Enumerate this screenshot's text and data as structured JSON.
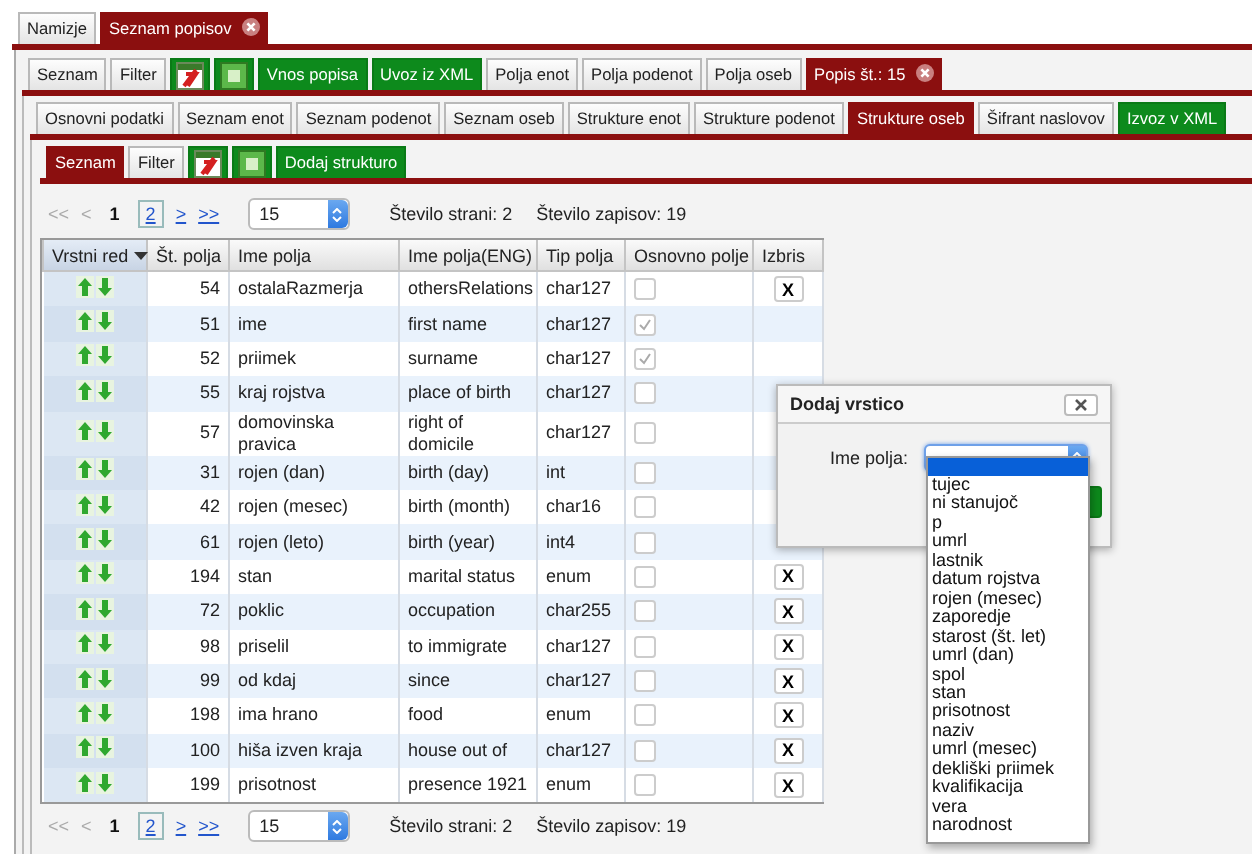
{
  "top_tabs": [
    {
      "label": "Namizje",
      "kind": "tab",
      "selected": false,
      "closable": false
    },
    {
      "label": "Seznam popisov",
      "kind": "tab",
      "selected": true,
      "closable": true
    }
  ],
  "popis_tabs": [
    {
      "label": "Seznam",
      "kind": "tab",
      "selected": false
    },
    {
      "label": "Filter",
      "kind": "tab",
      "selected": false
    },
    {
      "kind": "pdf",
      "selected": false
    },
    {
      "kind": "xls",
      "selected": false
    },
    {
      "label": "Vnos popisa",
      "kind": "action",
      "selected": false
    },
    {
      "label": "Uvoz iz XML",
      "kind": "action",
      "selected": false
    },
    {
      "label": "Polja enot",
      "kind": "tab",
      "selected": false
    },
    {
      "label": "Polja podenot",
      "kind": "tab",
      "selected": false
    },
    {
      "label": "Polja oseb",
      "kind": "tab",
      "selected": false
    },
    {
      "label": "Popis št.: 15",
      "kind": "tab",
      "selected": true,
      "closable": true
    }
  ],
  "detail_tabs": [
    {
      "label": "Osnovni podatki",
      "kind": "tab",
      "selected": false
    },
    {
      "label": "Seznam enot",
      "kind": "tab",
      "selected": false
    },
    {
      "label": "Seznam podenot",
      "kind": "tab",
      "selected": false
    },
    {
      "label": "Seznam oseb",
      "kind": "tab",
      "selected": false
    },
    {
      "label": "Strukture enot",
      "kind": "tab",
      "selected": false
    },
    {
      "label": "Strukture podenot",
      "kind": "tab",
      "selected": false
    },
    {
      "label": "Strukture oseb",
      "kind": "tab",
      "selected": true
    },
    {
      "label": "Šifrant naslovov",
      "kind": "tab",
      "selected": false
    },
    {
      "label": "Izvoz v XML",
      "kind": "action",
      "selected": false
    }
  ],
  "structure_tabs": [
    {
      "label": "Seznam",
      "kind": "tab",
      "selected": true
    },
    {
      "label": "Filter",
      "kind": "tab",
      "selected": false
    },
    {
      "kind": "pdf",
      "selected": false
    },
    {
      "kind": "xls",
      "selected": false
    },
    {
      "label": "Dodaj strukturo",
      "kind": "action",
      "selected": false
    }
  ],
  "pager_top": {
    "first": "<<",
    "prev": "<",
    "pages": [
      {
        "label": "1",
        "selected": true
      },
      {
        "label": "2",
        "selected": false
      }
    ],
    "next": ">",
    "last": ">>",
    "page_size": "15",
    "page_count": "Število strani: 2",
    "record_count": "Število zapisov: 19"
  },
  "table": {
    "columns": [
      {
        "label": "Vrstni red",
        "sorted": true
      },
      {
        "label": "Št. polja",
        "sorted": false
      },
      {
        "label": "Ime polja",
        "sorted": false
      },
      {
        "label": "Ime polja(ENG)",
        "sorted": false
      },
      {
        "label": "Tip polja",
        "sorted": false
      },
      {
        "label": "Osnovno polje",
        "sorted": false
      },
      {
        "label": "Izbris",
        "sorted": false
      }
    ],
    "rows": [
      {
        "number": "54",
        "name": "ostalaRazmerja",
        "name_eng": "othersRelations",
        "type": "char127",
        "basic": false,
        "delete": "X"
      },
      {
        "number": "51",
        "name": "ime",
        "name_eng": "first name",
        "type": "char127",
        "basic": true
      },
      {
        "number": "52",
        "name": "priimek",
        "name_eng": "surname",
        "type": "char127",
        "basic": true
      },
      {
        "number": "55",
        "name": "kraj rojstva",
        "name_eng": "place of birth",
        "type": "char127",
        "basic": false
      },
      {
        "number": "57",
        "name": "domovinska pravica",
        "name_eng": "right of domicile",
        "type": "char127",
        "basic": false
      },
      {
        "number": "31",
        "name": "rojen (dan)",
        "name_eng": "birth (day)",
        "type": "int",
        "basic": false
      },
      {
        "number": "42",
        "name": "rojen (mesec)",
        "name_eng": "birth (month)",
        "type": "char16",
        "basic": false
      },
      {
        "number": "61",
        "name": "rojen (leto)",
        "name_eng": "birth (year)",
        "type": "int4",
        "basic": false
      },
      {
        "number": "194",
        "name": "stan",
        "name_eng": "marital status",
        "type": "enum",
        "basic": false,
        "delete": "X"
      },
      {
        "number": "72",
        "name": "poklic",
        "name_eng": "occupation",
        "type": "char255",
        "basic": false,
        "delete": "X"
      },
      {
        "number": "98",
        "name": "priselil",
        "name_eng": "to immigrate",
        "type": "char127",
        "basic": false,
        "delete": "X"
      },
      {
        "number": "99",
        "name": "od kdaj",
        "name_eng": "since",
        "type": "char127",
        "basic": false,
        "delete": "X"
      },
      {
        "number": "198",
        "name": "ima hrano",
        "name_eng": "food",
        "type": "enum",
        "basic": false,
        "delete": "X"
      },
      {
        "number": "100",
        "name": "hiša izven kraja",
        "name_eng": "house out of",
        "type": "char127",
        "basic": false,
        "delete": "X"
      },
      {
        "number": "199",
        "name": "prisotnost",
        "name_eng": "presence 1921",
        "type": "enum",
        "basic": false,
        "delete": "X"
      }
    ]
  },
  "pager_bottom": {
    "first": "<<",
    "prev": "<",
    "pages": [
      {
        "label": "1",
        "selected": true
      },
      {
        "label": "2",
        "selected": false
      }
    ],
    "next": ">",
    "last": ">>",
    "page_size": "15",
    "page_count": "Število strani: 2",
    "record_count": "Število zapisov: 19"
  },
  "dialog": {
    "title": "Dodaj vrstico",
    "field_label": "Ime polja:",
    "dropdown": {
      "expanded": true,
      "blank_highlighted": true,
      "options": [
        "tujec",
        "ni stanujoč",
        "p",
        "umrl",
        "lastnik",
        "datum rojstva",
        "rojen (mesec)",
        "zaporedje",
        "starost (št. let)",
        "umrl (dan)",
        "spol",
        "stan",
        "prisotnost",
        "naziv",
        "umrl (mesec)",
        "dekliški priimek",
        "kvalifikacija",
        "vera",
        "narodnost"
      ]
    }
  }
}
